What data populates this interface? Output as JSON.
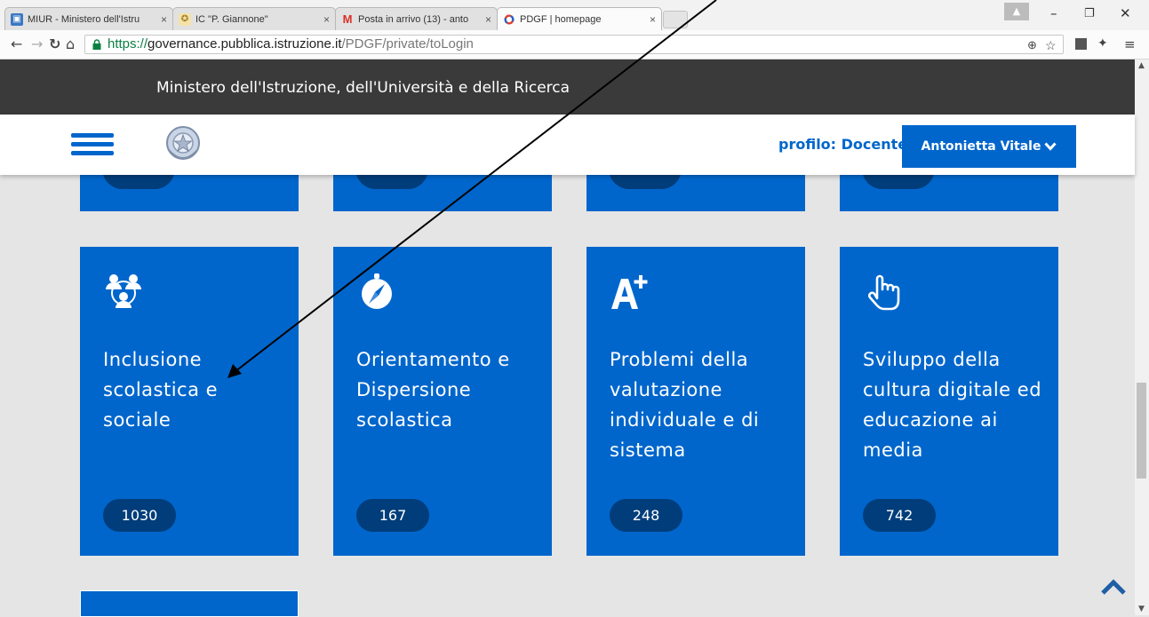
{
  "browser": {
    "tabs": [
      {
        "title": "MIUR - Ministero dell'Istru",
        "favicon": "miur-icon"
      },
      {
        "title": "IC \"P. Giannone\"",
        "favicon": "school-emblem-icon"
      },
      {
        "title": "Posta in arrivo (13) - anto",
        "favicon": "gmail-icon"
      },
      {
        "title": "PDGF | homepage",
        "favicon": "pdgf-icon",
        "active": true
      }
    ],
    "url": {
      "scheme": "https://",
      "host": "governance.pubblica.istruzione.it",
      "path": "/PDGF/private/toLogin"
    }
  },
  "header": {
    "ministry": "Ministero dell'Istruzione, dell'Università e della Ricerca"
  },
  "nav": {
    "profile_label": "profilo: Docente",
    "user_name": "Antonietta Vitale"
  },
  "cards": [
    {
      "title": "Inclusione scolastica e sociale",
      "count": "1030",
      "icon": "people-network-icon"
    },
    {
      "title": "Orientamento e Dispersione scolastica",
      "count": "167",
      "icon": "compass-icon"
    },
    {
      "title": "Problemi della valutazione individuale e di sistema",
      "count": "248",
      "icon": "a-plus-icon"
    },
    {
      "title": "Sviluppo della cultura digitale ed educazione ai media",
      "count": "742",
      "icon": "pointing-hand-icon"
    }
  ],
  "colors": {
    "card_blue": "#0066cc",
    "pill_dark": "#003d7a",
    "header_dark": "#3a3a3b",
    "page_bg": "#e5e5e5"
  }
}
